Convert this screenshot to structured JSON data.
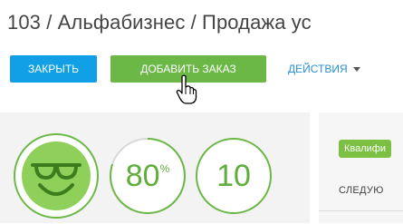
{
  "header": {
    "title": "103 / Альфабизнес / Продажа ус"
  },
  "toolbar": {
    "close_label": "ЗАКРЫТЬ",
    "add_order_label": "ДОБАВИТЬ ЗАКАЗ",
    "actions_label": "ДЕЙСТВИЯ"
  },
  "metrics": {
    "probability_value": "80",
    "probability_unit": "%",
    "probability_fraction": 0.8,
    "count_value": "10"
  },
  "stage": {
    "badge_label": "Квалифи",
    "next_label": "СЛЕДУЮ"
  },
  "colors": {
    "close_button": "#11a0e5",
    "add_button": "#6bb847",
    "actions_link": "#2a8fd6",
    "gauge_green": "#6bb847",
    "rating_fill": "#8fd05a",
    "stage_badge": "#7cc043"
  },
  "icons": {
    "rating": "smiley-sunglasses-icon",
    "cursor": "hand-pointer-icon",
    "actions_caret": "caret-down-icon"
  }
}
